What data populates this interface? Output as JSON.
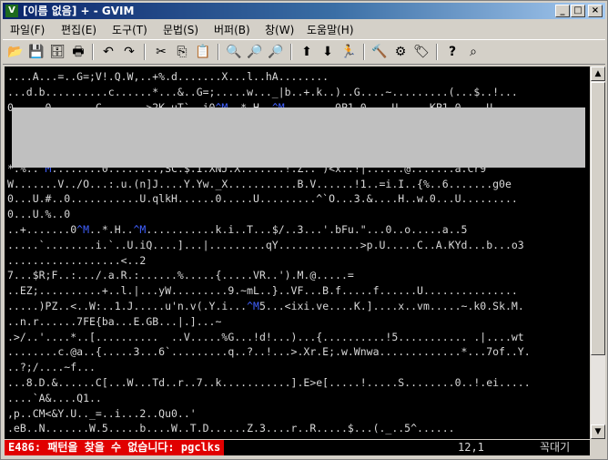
{
  "window": {
    "title": "[이름 없음] + - GVIM",
    "app_icon": "vim-icon",
    "controls": {
      "minimize": "_",
      "maximize": "□",
      "close": "×"
    }
  },
  "menu": [
    {
      "label": "파일(F)"
    },
    {
      "label": "편집(E)"
    },
    {
      "label": "도구(T)"
    },
    {
      "label": "문법(S)"
    },
    {
      "label": "버퍼(B)"
    },
    {
      "label": "창(W)"
    },
    {
      "label": "도움말(H)"
    }
  ],
  "toolbar": {
    "icons": [
      {
        "name": "open-icon",
        "glyph": "📂"
      },
      {
        "name": "save-icon",
        "glyph": "💾"
      },
      {
        "name": "save-all-icon",
        "glyph": "🗄"
      },
      {
        "name": "print-icon",
        "glyph": "🖶"
      },
      {
        "name": "undo-icon",
        "glyph": "↶"
      },
      {
        "name": "redo-icon",
        "glyph": "↷"
      },
      {
        "name": "cut-icon",
        "glyph": "✂"
      },
      {
        "name": "copy-icon",
        "glyph": "⎘"
      },
      {
        "name": "paste-icon",
        "glyph": "📋"
      },
      {
        "name": "find-replace-icon",
        "glyph": "🔍"
      },
      {
        "name": "find-next-icon",
        "glyph": "🔎"
      },
      {
        "name": "find-prev-icon",
        "glyph": "🔎"
      },
      {
        "name": "load-session-icon",
        "glyph": "⬆"
      },
      {
        "name": "save-session-icon",
        "glyph": "⬇"
      },
      {
        "name": "run-script-icon",
        "glyph": "🏃"
      },
      {
        "name": "make-icon",
        "glyph": "🔨"
      },
      {
        "name": "shell-icon",
        "glyph": "⚙"
      },
      {
        "name": "tag-jump-icon",
        "glyph": "🏷"
      },
      {
        "name": "help-icon",
        "glyph": "?"
      },
      {
        "name": "help-search-icon",
        "glyph": "⌕"
      }
    ]
  },
  "editor": {
    "lines": [
      "....A...=..G=;V!.Q.W,..+%.d.......X...l..hA........",
      "...d.b..........c......*...&..G=;.....w..._|b..+.k..)..G....~.........(...$..!...",
      "0.....0.......C.......>2K.uT`..i0^M..*.H..^M........0P1.0....U.....KP1.0....U....",
      "",
      "",
      "",
      "*.%..^M........0........,SC.$.I.XNJ.X.......!.Z..`)<x..!|......@.......a.Cr9",
      "W.......V../O...:.u.(n]J....Y.Yw._X...........B.V......!1..=i.I..{%..6.......g0e",
      "0...U.#..0...........U.qlkH......0.....U.........^`O...3.&....H..w.0...U.........",
      "0...U.%..0",
      "..+.......0^M..*.H..^M...........k.i..T...$/..3...'.bFu.\"...0..o.....a..5",
      ".....`........i.`..U.iQ....]...|.........qY.............>p.U.....C..A.KYd...b...o3",
      "..................<..2",
      "7...$R;F..:.../.a.R.:......%.....{.....VR..').M.@.....=",
      "..EZ;..........+..l.|...yW.........9.~mL..}..VF...B.f.....f......U...............",
      ".....)PZ..<..W:..1.J.....u'n.v(.Y.i...^M5...<ixi.ve....K.]....x..vm.....~.k0.Sk.M.",
      "..n.r......7FE{ba...E.GB...|.]...~",
      ".>/..'....*..[..........  ..V.....%G...!d!...)...{..........!5........... .|....wt",
      "........c.@a..{.....3...6`.........q..?..!...>.Xr.E;.w.Wnwa.............*...7of..Y.",
      "..?;/....~f...",
      "...8.D.&......C[...W...Td..r..7..k...........].E>e[.....!.....S........0..!.ei.....",
      "....`A&....Q1..",
      ",p..CM<&Y.U.._=..i...2..Qu0..'",
      ".eB..N.......W.5.....b....W..T.D......Z.3....r..R.....$...(._..5^......"
    ]
  },
  "status": {
    "message": "E486: 패턴을 찾을 수 없습니다: pgclks",
    "position": "12,1",
    "percent": "꼭대기"
  },
  "colors": {
    "editor_bg": "#000000",
    "error_bg": "#e00000",
    "special_key": "#4060ff"
  }
}
